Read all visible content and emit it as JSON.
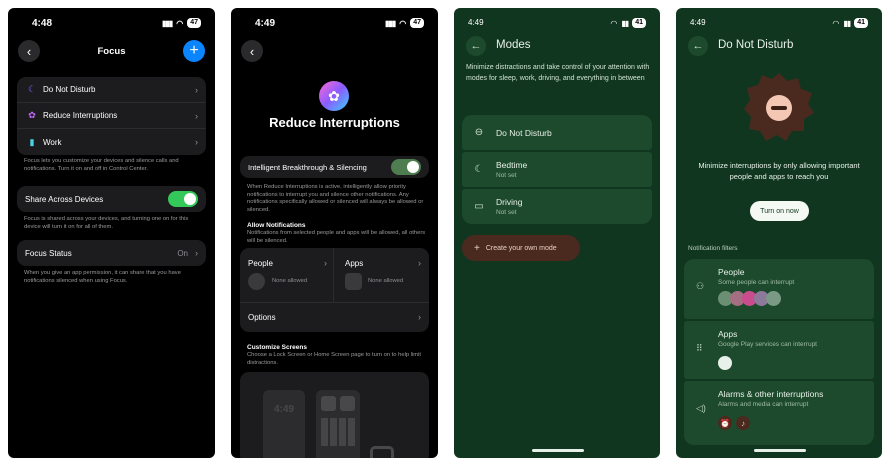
{
  "ios_focus": {
    "status": {
      "time": "4:48",
      "battery": "47"
    },
    "title": "Focus",
    "items": [
      {
        "label": "Do Not Disturb",
        "icon": "moon-icon"
      },
      {
        "label": "Reduce Interruptions",
        "icon": "flower-icon"
      },
      {
        "label": "Work",
        "icon": "badge-icon"
      }
    ],
    "focus_footer": "Focus lets you customize your devices and silence calls and notifications. Turn it on and off in Control Center.",
    "share_label": "Share Across Devices",
    "share_footer": "Focus is shared across your devices, and turning one on for this device will turn it on for all of them.",
    "status_label": "Focus Status",
    "status_value": "On",
    "status_footer": "When you give an app permission, it can share that you have notifications silenced when using Focus."
  },
  "ios_reduce": {
    "status": {
      "time": "4:49",
      "battery": "47"
    },
    "title": "Reduce Interruptions",
    "breakthrough_label": "Intelligent Breakthrough & Silencing",
    "breakthrough_desc": "When Reduce Interruptions is active, intelligently allow priority notifications to interrupt you and silence other notifications. Any notifications specifically allowed or silenced will always be allowed or silenced.",
    "allow_heading": "Allow Notifications",
    "allow_desc": "Notifications from selected people and apps will be allowed, all others will be silenced.",
    "people_label": "People",
    "apps_label": "Apps",
    "none_allowed": "None allowed",
    "options_label": "Options",
    "customize_heading": "Customize Screens",
    "customize_desc": "Choose a Lock Screen or Home Screen page to turn on to help limit distractions.",
    "lock_time": "4:49"
  },
  "android_modes": {
    "status": {
      "time": "4:49",
      "battery": "41"
    },
    "title": "Modes",
    "description": "Minimize distractions and take control of your attention with modes for sleep, work, driving, and everything in between",
    "modes": [
      {
        "title": "Do Not Disturb",
        "sub": "",
        "icon": "minus-circle-icon"
      },
      {
        "title": "Bedtime",
        "sub": "Not set",
        "icon": "moon-icon"
      },
      {
        "title": "Driving",
        "sub": "Not set",
        "icon": "car-icon"
      }
    ],
    "create_label": "Create your own mode"
  },
  "android_dnd": {
    "status": {
      "time": "4:49",
      "battery": "41"
    },
    "title": "Do Not Disturb",
    "description": "Minimize interruptions by only allowing important people and apps to reach you",
    "turn_on_label": "Turn on now",
    "filters_heading": "Notification filters",
    "filters": [
      {
        "title": "People",
        "sub": "Some people can interrupt",
        "icon": "people-icon"
      },
      {
        "title": "Apps",
        "sub": "Google Play services can interrupt",
        "icon": "grid-icon"
      },
      {
        "title": "Alarms & other interruptions",
        "sub": "Alarms and media can interrupt",
        "icon": "speaker-icon"
      }
    ]
  }
}
